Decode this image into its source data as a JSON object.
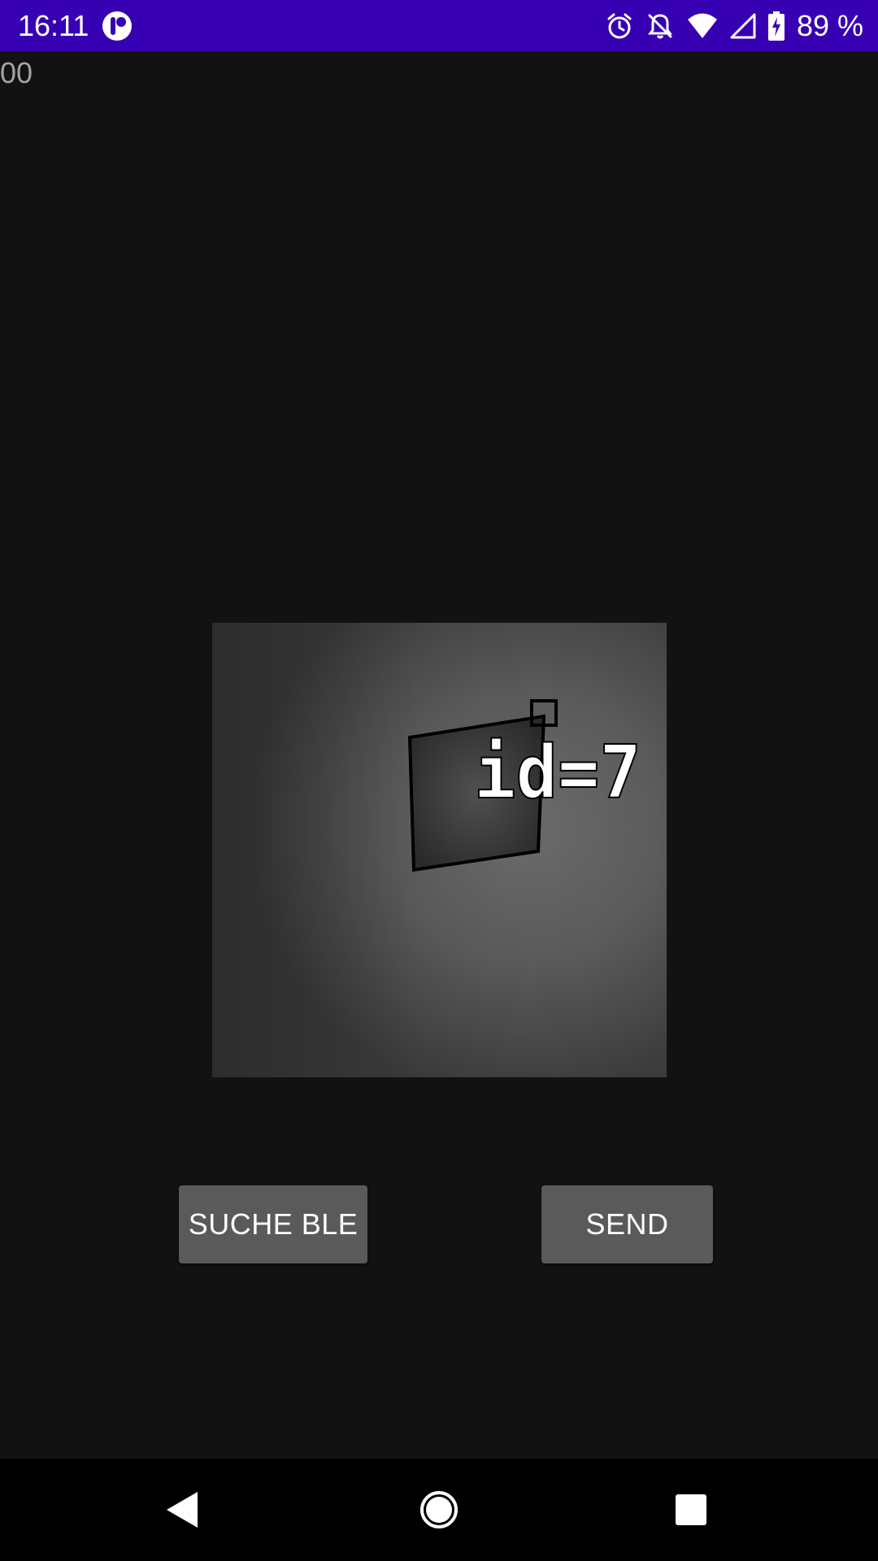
{
  "status_bar": {
    "time": "16:11",
    "battery_percent": "89 %",
    "icons": [
      "app-notification-icon",
      "alarm-icon",
      "notifications-off-icon",
      "wifi-icon",
      "cell-signal-icon",
      "battery-charging-icon"
    ],
    "background_color": "#3700b3"
  },
  "main": {
    "counter_text": "00",
    "camera_preview": {
      "overlay_label": "id=7"
    }
  },
  "buttons": {
    "search_ble_label": "SUCHE BLE",
    "send_label": "SEND"
  },
  "nav_bar": {
    "icons": [
      "back-icon",
      "home-icon",
      "recents-icon"
    ]
  }
}
